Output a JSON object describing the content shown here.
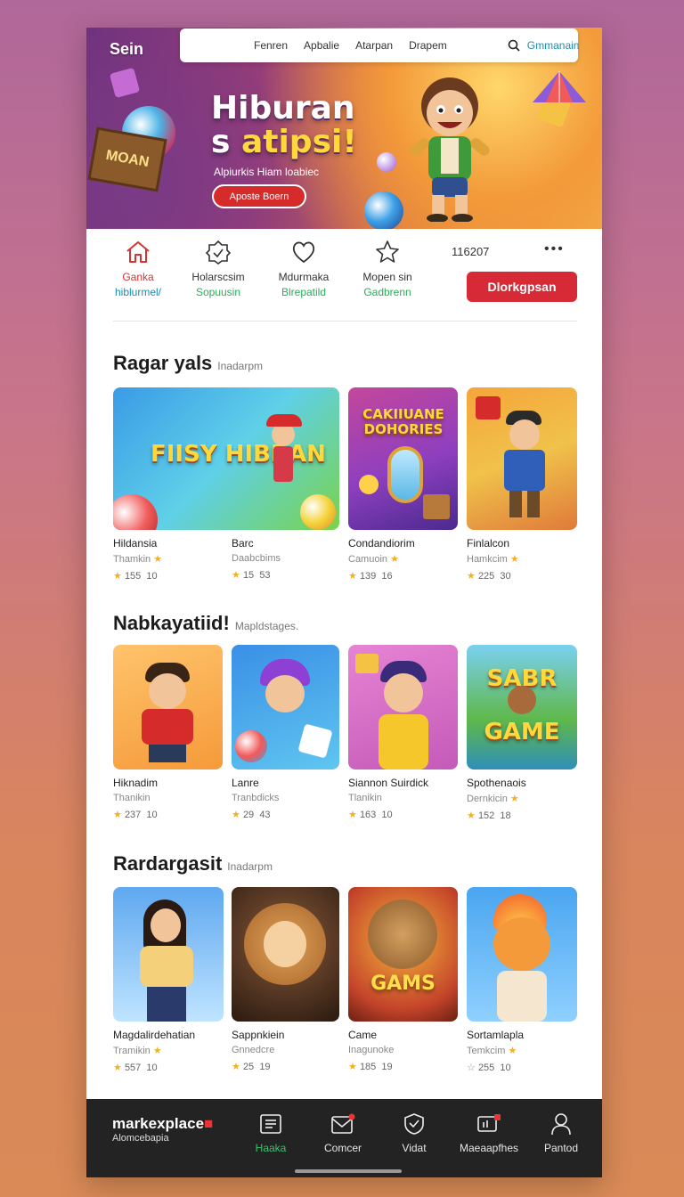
{
  "header": {
    "brand": "Sein",
    "nav": [
      "Fenren",
      "Apbalie",
      "Atarpan",
      "Drapem"
    ],
    "search_label": "Gmmanain"
  },
  "hero": {
    "title_line1": "Hiburan",
    "title_line2_a": "s ",
    "title_line2_b": "atipsi!",
    "subtitle": "Alpiurkis Hiam loabiec",
    "cta": "Aposte Boern",
    "sign_text": "MOAN"
  },
  "categories": [
    {
      "icon": "home-icon",
      "line1": "Ganka",
      "line2": "hiblurmel/",
      "active": true
    },
    {
      "icon": "badge-icon",
      "line1": "Holarscsim",
      "line2": "Sopuusin",
      "active": false
    },
    {
      "icon": "heart-icon",
      "line1": "Mdurmaka",
      "line2": "Blrepatild",
      "active": false
    },
    {
      "icon": "star-icon",
      "line1": "Mopen sin",
      "line2": "Gadbrenn",
      "active": false
    }
  ],
  "category_count": "116207",
  "category_more": "•••",
  "category_button": "Dlorkgpsan",
  "sections": [
    {
      "title": "Ragar yals",
      "subtitle": "Inadarpm",
      "items": [
        {
          "name": "Hildansia",
          "dev": "Thamkin",
          "rating": "155",
          "count": "10",
          "art": "FIISY HIBRAN"
        },
        {
          "name": "Barc",
          "dev": "Daabcbims",
          "rating": "15",
          "count": "53",
          "art": ""
        },
        {
          "name": "Condandiorim",
          "dev": "Camuoin",
          "rating": "139",
          "count": "16",
          "art": "CAKIIUANE DOHORIES"
        },
        {
          "name": "Finlalcon",
          "dev": "Hamkcim",
          "rating": "225",
          "count": "30",
          "art": ""
        }
      ]
    },
    {
      "title": "Nabkayatiid!",
      "subtitle": "Mapldstages.",
      "items": [
        {
          "name": "Hiknadim",
          "dev": "Thanikin",
          "rating": "237",
          "count": "10",
          "art": ""
        },
        {
          "name": "Lanre",
          "dev": "Tranbdicks",
          "rating": "29",
          "count": "43",
          "art": ""
        },
        {
          "name": "Siannon Suirdick",
          "dev": "Tlanikin",
          "rating": "163",
          "count": "10",
          "art": ""
        },
        {
          "name": "Spothenaois",
          "dev": "Dernkicin",
          "rating": "152",
          "count": "18",
          "art": "SABR GAME"
        }
      ]
    },
    {
      "title": "Rardargasit",
      "subtitle": "Inadarpm",
      "items": [
        {
          "name": "Magdalirdehatian",
          "dev": "Tramikin",
          "rating": "557",
          "count": "10",
          "art": ""
        },
        {
          "name": "Sappnkiein",
          "dev": "Gnnedcre",
          "rating": "25",
          "count": "19",
          "art": ""
        },
        {
          "name": "Came",
          "dev": "Inagunoke",
          "rating": "185",
          "count": "19",
          "art": "GAMS"
        },
        {
          "name": "Sortamlapla",
          "dev": "Temkcim",
          "rating": "255",
          "count": "10",
          "art": ""
        }
      ]
    }
  ],
  "bottom_nav": {
    "logo": "markexplace",
    "logo_dot": "■",
    "logo_sub": "Alomcebapia",
    "items": [
      {
        "icon": "list-icon",
        "label": "Haaka",
        "active": true
      },
      {
        "icon": "mail-icon",
        "label": "Comcer",
        "active": false
      },
      {
        "icon": "shield-icon",
        "label": "Vidat",
        "active": false
      },
      {
        "icon": "message-icon",
        "label": "Maeaapfhes",
        "active": false
      },
      {
        "icon": "user-icon",
        "label": "Pantod",
        "active": false
      }
    ]
  },
  "colors": {
    "accent_red": "#d62b36",
    "accent_green": "#2eaa5a",
    "accent_blue": "#1a8fb3",
    "star": "#f2b024"
  }
}
